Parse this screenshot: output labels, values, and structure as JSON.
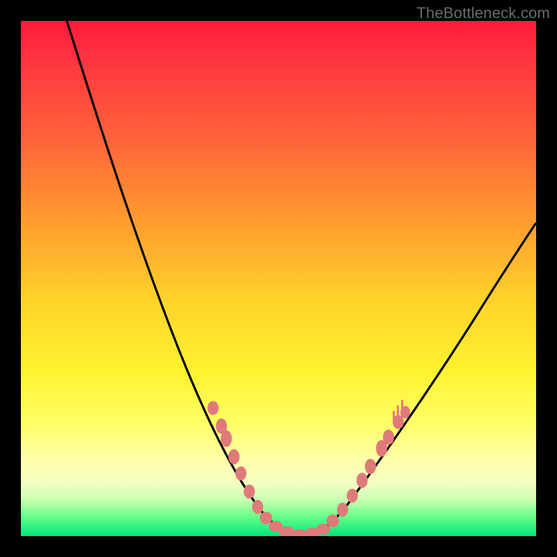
{
  "watermark": "TheBottleneck.com",
  "colors": {
    "background": "#000000",
    "curve": "#000000",
    "markers": "#e07a7a"
  },
  "chart_data": {
    "type": "line",
    "title": "",
    "xlabel": "",
    "ylabel": "",
    "xlim": [
      0,
      100
    ],
    "ylim": [
      0,
      100
    ],
    "grid": false,
    "legend": false,
    "series": [
      {
        "name": "bottleneck_curve",
        "x": [
          9,
          12,
          15,
          18,
          21,
          24,
          27,
          30,
          33,
          36,
          38,
          40,
          42,
          44,
          46,
          48,
          50,
          52,
          54,
          56,
          58,
          60,
          62,
          65,
          68,
          72,
          76,
          80,
          84,
          88,
          92,
          96,
          100
        ],
        "y": [
          100,
          92,
          84,
          76,
          68,
          60,
          52,
          45,
          38,
          32,
          28,
          24,
          20,
          16,
          12,
          8,
          4,
          1,
          0,
          0,
          1,
          3,
          6,
          10,
          15,
          21,
          27,
          33,
          39,
          45,
          51,
          56,
          61
        ]
      }
    ],
    "highlighted_points": {
      "name": "marker_cluster",
      "x": [
        38,
        40,
        42,
        44,
        46,
        48,
        50,
        52,
        54,
        56,
        58,
        60,
        62,
        64,
        66,
        68
      ],
      "y": [
        28,
        23,
        18,
        14,
        10,
        6,
        3,
        1,
        0,
        0,
        1,
        3,
        6,
        10,
        14,
        18
      ]
    }
  }
}
